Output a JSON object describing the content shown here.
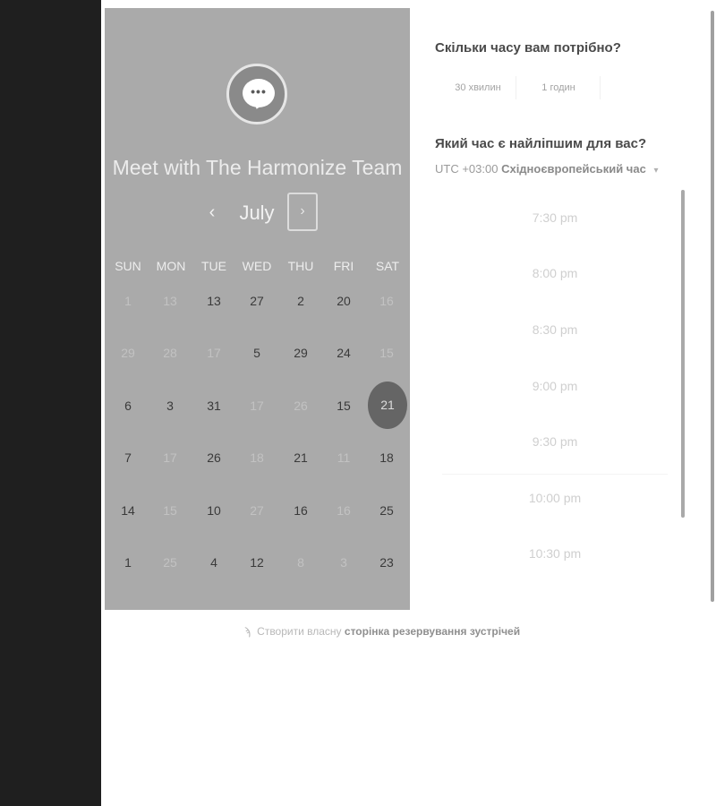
{
  "calendar": {
    "title": "Meet with The Harmonize Team",
    "month": "July",
    "prev_icon": "‹",
    "next_icon": "›",
    "weekdays": [
      "SUN",
      "MON",
      "TUE",
      "WED",
      "THU",
      "FRI",
      "SAT"
    ],
    "weeks": [
      [
        {
          "d": "1",
          "on": false
        },
        {
          "d": "13",
          "on": false
        },
        {
          "d": "13",
          "on": true
        },
        {
          "d": "27",
          "on": true
        },
        {
          "d": "2",
          "on": true
        },
        {
          "d": "20",
          "on": true
        },
        {
          "d": "16",
          "on": false
        }
      ],
      [
        {
          "d": "29",
          "on": false
        },
        {
          "d": "28",
          "on": false
        },
        {
          "d": "17",
          "on": false
        },
        {
          "d": "5",
          "on": true
        },
        {
          "d": "29",
          "on": true
        },
        {
          "d": "24",
          "on": true
        },
        {
          "d": "15",
          "on": false
        }
      ],
      [
        {
          "d": "6",
          "on": true
        },
        {
          "d": "3",
          "on": true
        },
        {
          "d": "31",
          "on": true
        },
        {
          "d": "17",
          "on": false
        },
        {
          "d": "26",
          "on": false
        },
        {
          "d": "15",
          "on": true
        },
        {
          "d": "21",
          "on": true,
          "selected": true
        }
      ],
      [
        {
          "d": "7",
          "on": true
        },
        {
          "d": "17",
          "on": false
        },
        {
          "d": "26",
          "on": true
        },
        {
          "d": "18",
          "on": false
        },
        {
          "d": "21",
          "on": true
        },
        {
          "d": "11",
          "on": false
        },
        {
          "d": "18",
          "on": true
        }
      ],
      [
        {
          "d": "14",
          "on": true
        },
        {
          "d": "15",
          "on": false
        },
        {
          "d": "10",
          "on": true
        },
        {
          "d": "27",
          "on": false
        },
        {
          "d": "16",
          "on": true
        },
        {
          "d": "16",
          "on": false
        },
        {
          "d": "25",
          "on": true
        }
      ],
      [
        {
          "d": "1",
          "on": true
        },
        {
          "d": "25",
          "on": false
        },
        {
          "d": "4",
          "on": true
        },
        {
          "d": "12",
          "on": true
        },
        {
          "d": "8",
          "on": false
        },
        {
          "d": "3",
          "on": false
        },
        {
          "d": "23",
          "on": true
        }
      ]
    ],
    "selected_day": "21"
  },
  "duration": {
    "question": "Скільки часу вам потрібно?",
    "options": [
      "30 хвилин",
      "1 годин"
    ]
  },
  "time": {
    "question": "Який час є найліпшим для вас?",
    "tz_offset": "UTC +03:00",
    "tz_name": "Східноєвропейський час",
    "tz_caret": "▾",
    "slots": [
      "7:30 pm",
      "8:00 pm",
      "8:30 pm",
      "9:00 pm",
      "9:30 pm",
      "10:00 pm",
      "10:30 pm"
    ]
  },
  "footer": {
    "icon": "ϡ",
    "plain": "Створити власну",
    "link": "сторінка резервування зустрічей"
  },
  "colors": {
    "sidebar": "#1f1f1f",
    "calendar_panel": "#aaaaaa",
    "selected_day": "#656565"
  }
}
